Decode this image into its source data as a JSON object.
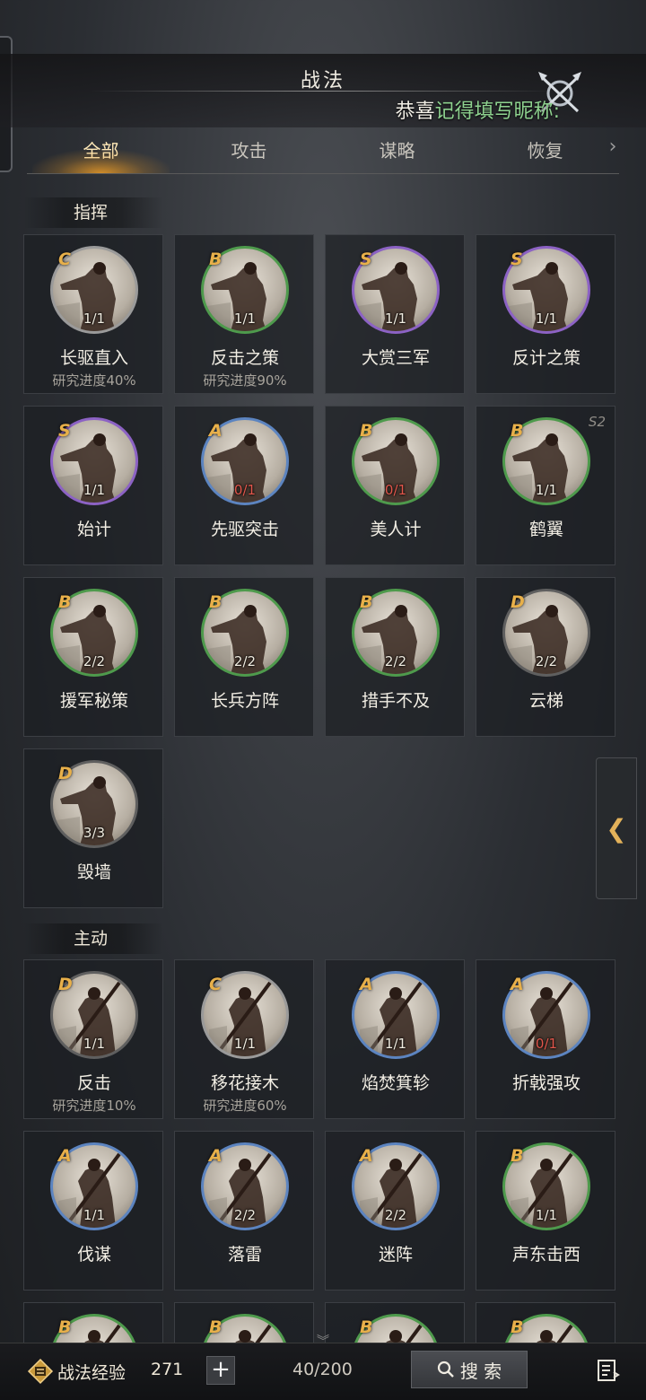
{
  "header": {
    "title": "战法",
    "notice_prefix": "恭喜",
    "notice_highlight": "记得填写昵称:",
    "close_icon": "crossed-swords-close-icon"
  },
  "tabs": [
    {
      "label": "全部",
      "active": true
    },
    {
      "label": "攻击",
      "active": false
    },
    {
      "label": "谋略",
      "active": false
    },
    {
      "label": "恢复",
      "active": false
    }
  ],
  "sections": {
    "command": {
      "label": "指挥",
      "cards": [
        {
          "grade": "C",
          "count": "1/1",
          "name": "长驱直入",
          "progress": "研究进度40%",
          "ring": "#9a9a9a",
          "count_red": false,
          "season": ""
        },
        {
          "grade": "B",
          "count": "1/1",
          "name": "反击之策",
          "progress": "研究进度90%",
          "ring": "#4e9a4c",
          "count_red": false,
          "season": ""
        },
        {
          "grade": "S",
          "count": "1/1",
          "name": "大赏三军",
          "progress": "",
          "ring": "#8c62c4",
          "count_red": false,
          "season": ""
        },
        {
          "grade": "S",
          "count": "1/1",
          "name": "反计之策",
          "progress": "",
          "ring": "#8c62c4",
          "count_red": false,
          "season": ""
        },
        {
          "grade": "S",
          "count": "1/1",
          "name": "始计",
          "progress": "",
          "ring": "#8c62c4",
          "count_red": false,
          "season": ""
        },
        {
          "grade": "A",
          "count": "0/1",
          "name": "先驱突击",
          "progress": "",
          "ring": "#5c84c0",
          "count_red": true,
          "season": ""
        },
        {
          "grade": "B",
          "count": "0/1",
          "name": "美人计",
          "progress": "",
          "ring": "#4e9a4c",
          "count_red": true,
          "season": ""
        },
        {
          "grade": "B",
          "count": "1/1",
          "name": "鹤翼",
          "progress": "",
          "ring": "#4e9a4c",
          "count_red": false,
          "season": "S2"
        },
        {
          "grade": "B",
          "count": "2/2",
          "name": "援军秘策",
          "progress": "",
          "ring": "#4e9a4c",
          "count_red": false,
          "season": ""
        },
        {
          "grade": "B",
          "count": "2/2",
          "name": "长兵方阵",
          "progress": "",
          "ring": "#4e9a4c",
          "count_red": false,
          "season": ""
        },
        {
          "grade": "B",
          "count": "2/2",
          "name": "措手不及",
          "progress": "",
          "ring": "#4e9a4c",
          "count_red": false,
          "season": ""
        },
        {
          "grade": "D",
          "count": "2/2",
          "name": "云梯",
          "progress": "",
          "ring": "#5f5f5f",
          "count_red": false,
          "season": ""
        },
        {
          "grade": "D",
          "count": "3/3",
          "name": "毁墙",
          "progress": "",
          "ring": "#5f5f5f",
          "count_red": false,
          "season": ""
        }
      ]
    },
    "active": {
      "label": "主动",
      "cards": [
        {
          "grade": "D",
          "count": "1/1",
          "name": "反击",
          "progress": "研究进度10%",
          "ring": "#5f5f5f",
          "count_red": false,
          "season": ""
        },
        {
          "grade": "C",
          "count": "1/1",
          "name": "移花接木",
          "progress": "研究进度60%",
          "ring": "#9a9a9a",
          "count_red": false,
          "season": ""
        },
        {
          "grade": "A",
          "count": "1/1",
          "name": "焰焚箕轸",
          "progress": "",
          "ring": "#5c84c0",
          "count_red": false,
          "season": ""
        },
        {
          "grade": "A",
          "count": "0/1",
          "name": "折戟强攻",
          "progress": "",
          "ring": "#5c84c0",
          "count_red": true,
          "season": ""
        },
        {
          "grade": "A",
          "count": "1/1",
          "name": "伐谋",
          "progress": "",
          "ring": "#5c84c0",
          "count_red": false,
          "season": ""
        },
        {
          "grade": "A",
          "count": "2/2",
          "name": "落雷",
          "progress": "",
          "ring": "#5c84c0",
          "count_red": false,
          "season": ""
        },
        {
          "grade": "A",
          "count": "2/2",
          "name": "迷阵",
          "progress": "",
          "ring": "#5c84c0",
          "count_red": false,
          "season": ""
        },
        {
          "grade": "B",
          "count": "1/1",
          "name": "声东击西",
          "progress": "",
          "ring": "#4e9a4c",
          "count_red": false,
          "season": ""
        },
        {
          "grade": "B",
          "count": "",
          "name": "",
          "progress": "",
          "ring": "#4e9a4c",
          "count_red": false,
          "season": ""
        },
        {
          "grade": "B",
          "count": "",
          "name": "",
          "progress": "",
          "ring": "#4e9a4c",
          "count_red": false,
          "season": ""
        },
        {
          "grade": "B",
          "count": "",
          "name": "",
          "progress": "",
          "ring": "#4e9a4c",
          "count_red": false,
          "season": ""
        },
        {
          "grade": "B",
          "count": "",
          "name": "",
          "progress": "",
          "ring": "#4e9a4c",
          "count_red": false,
          "season": ""
        }
      ]
    }
  },
  "bottom": {
    "exp_label": "战法经验",
    "exp_value": "271",
    "plus_label": "+",
    "capacity": "40/200",
    "search_label": "搜 索",
    "exp_icon": "tactics-exp-icon",
    "search_icon": "search-icon",
    "list_icon": "list-exit-icon"
  },
  "side_collapse_label": "❮",
  "tab_more_label": "›"
}
